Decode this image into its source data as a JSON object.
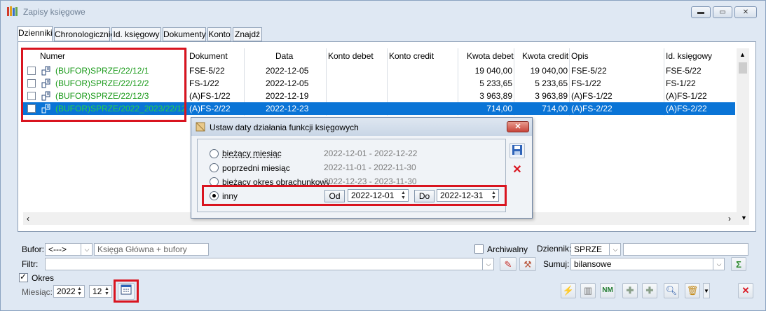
{
  "window": {
    "title": "Zapisy księgowe"
  },
  "tabs": [
    "Dzienniki",
    "Chronologicznie",
    "Id. księgowy",
    "Dokumenty",
    "Konto",
    "Znajdź"
  ],
  "grid": {
    "columns": [
      "Numer",
      "Dokument",
      "Data",
      "Konto debet",
      "Konto credit",
      "Kwota debet",
      "Kwota credit",
      "Opis",
      "Id. księgowy"
    ],
    "rows": [
      {
        "numer": "(BUFOR)SPRZE/22/12/1",
        "dokument": "FSE-5/22",
        "data": "2022-12-05",
        "konto_debet": "",
        "konto_credit": "",
        "kwota_debet": "19 040,00",
        "kwota_credit": "19 040,00",
        "opis": "FSE-5/22",
        "id": "FSE-5/22"
      },
      {
        "numer": "(BUFOR)SPRZE/22/12/2",
        "dokument": "FS-1/22",
        "data": "2022-12-05",
        "konto_debet": "",
        "konto_credit": "",
        "kwota_debet": "5 233,65",
        "kwota_credit": "5 233,65",
        "opis": "FS-1/22",
        "id": "FS-1/22"
      },
      {
        "numer": "(BUFOR)SPRZE/22/12/3",
        "dokument": "(A)FS-1/22",
        "data": "2022-12-19",
        "konto_debet": "",
        "konto_credit": "",
        "kwota_debet": "3 963,89",
        "kwota_credit": "3 963,89",
        "opis": "(A)FS-1/22",
        "id": "(A)FS-1/22"
      },
      {
        "numer": "(BUFOR)SPRZE/2022_2023/22/12/1",
        "dokument": "(A)FS-2/22",
        "data": "2022-12-23",
        "konto_debet": "",
        "konto_credit": "",
        "kwota_debet": "714,00",
        "kwota_credit": "714,00",
        "opis": "(A)FS-2/22",
        "id": "(A)FS-2/22"
      }
    ]
  },
  "dialog": {
    "title": "Ustaw daty działania funkcji księgowych",
    "options": [
      {
        "label": "bieżący miesiąc",
        "range": "2022-12-01 - 2022-12-22"
      },
      {
        "label": "poprzedni miesiąc",
        "range": "2022-11-01 - 2022-11-30"
      },
      {
        "label": "bieżący okres obrachunkowy",
        "range": "2022-12-23 - 2023-11-30"
      },
      {
        "label": "inny",
        "range": ""
      }
    ],
    "od_label": "Od",
    "od_value": "2022-12-01",
    "do_label": "Do",
    "do_value": "2022-12-31"
  },
  "bottom": {
    "bufor_label": "Bufor:",
    "bufor_value": "<--->",
    "bufor_desc": "Księga Główna + bufory",
    "archiwalny_label": "Archiwalny",
    "dziennik_label": "Dziennik:",
    "dziennik_value": "SPRZE",
    "filtr_label": "Filtr:",
    "sumuj_label": "Sumuj:",
    "sumuj_value": "bilansowe",
    "okres_label": "Okres",
    "miesiac_label": "Miesiąc:",
    "year": "2022",
    "month": "12",
    "nm_label": "NM"
  },
  "colors": {
    "selection": "#0a74d6",
    "green_text": "#1a9a1a",
    "highlight": "#d9141f"
  }
}
